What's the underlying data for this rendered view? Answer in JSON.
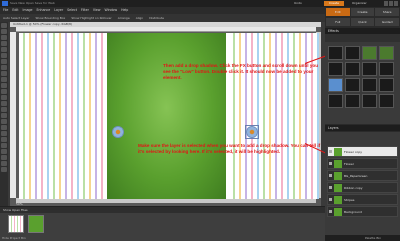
{
  "app": {
    "undo_label": "Undo",
    "create_label": "Create",
    "organizer_label": "Organizer",
    "title_menus": "Save  New  Open  Save for Web"
  },
  "menubar": [
    "File",
    "Edit",
    "Image",
    "Enhance",
    "Layer",
    "Select",
    "Filter",
    "View",
    "Window",
    "Help"
  ],
  "options_bar": [
    "Auto Select Layer",
    "Show Bounding Box",
    "Show Highlight on Rollover",
    "Arrange",
    "Align",
    "Distribute"
  ],
  "document": {
    "window_title": "Untitled-1 @ 50% (Flower copy, RGB/8)",
    "zoom": "50%"
  },
  "annotations": {
    "top": "Then add a drop shadow. Click the FX button and scroll down until you see the \"Low\" button. Double click it. It should now be added to your element.",
    "bottom": "Make sure the layer is selected when you want to add a drop shadow. You can tell if it's selected by looking here. If it's selected, it will be highlighted."
  },
  "project_bin": {
    "tab_label": "Show Open Files",
    "bin_label": "Hide Project Bin"
  },
  "panels": {
    "tabs": [
      "Edit",
      "Create",
      "Share"
    ],
    "active_tab": "Edit",
    "subtabs": [
      "Full",
      "Quick",
      "Guided"
    ],
    "effects_header": "Effects",
    "layers_header": "Layers",
    "layers": [
      {
        "name": "Flower copy",
        "selected": true
      },
      {
        "name": "Flower",
        "selected": false
      },
      {
        "name": "BG_PaperGreen",
        "selected": false
      },
      {
        "name": "Ribbon copy",
        "selected": false
      },
      {
        "name": "Stripes",
        "selected": false
      },
      {
        "name": "Background",
        "selected": false
      }
    ],
    "footer": "Palette Bin"
  },
  "colors": {
    "annotation": "#e11515",
    "create_button": "#d8781b",
    "selected_layer": "#e9e9e9"
  }
}
